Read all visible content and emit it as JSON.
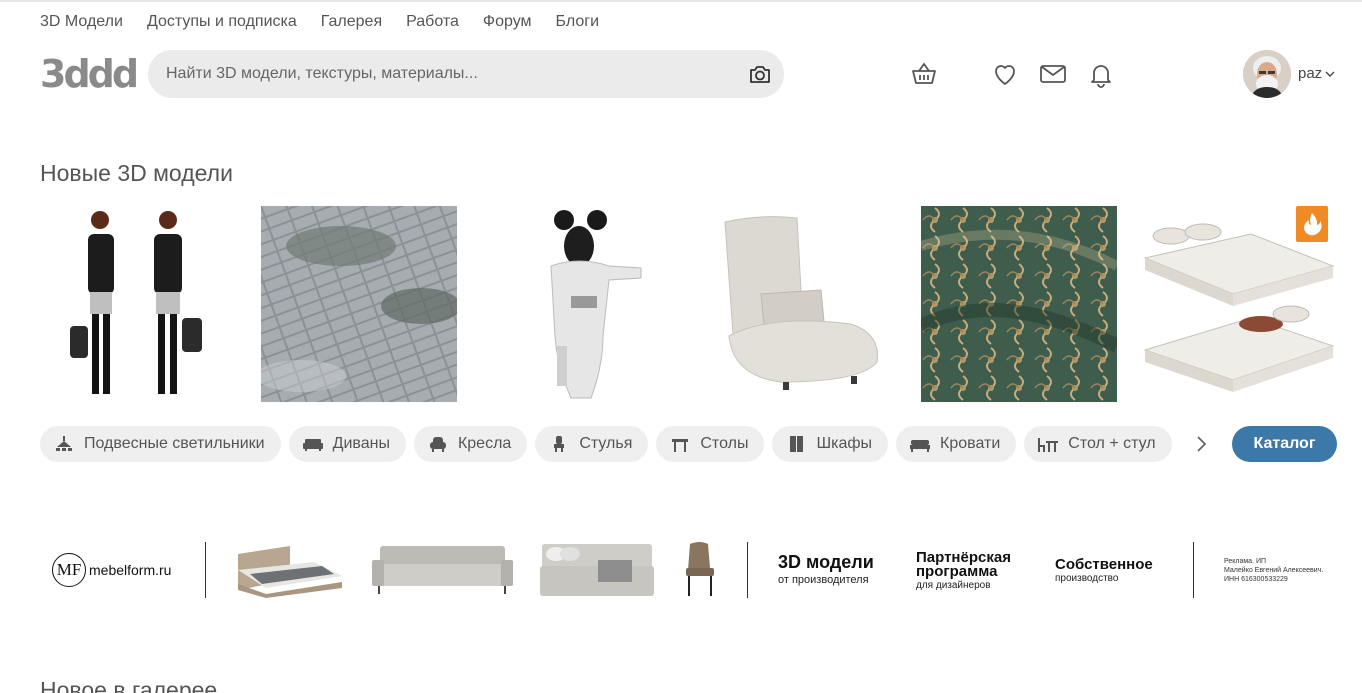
{
  "nav": {
    "items": [
      "3D Модели",
      "Доступы и подписка",
      "Галерея",
      "Работа",
      "Форум",
      "Блоги"
    ]
  },
  "logo": {
    "text": "3ddd"
  },
  "search": {
    "placeholder": "Найти 3D модели, текстуры, материалы...",
    "value": ""
  },
  "header_icons": [
    "basket-icon",
    "heart-icon",
    "mail-icon",
    "bell-icon"
  ],
  "user": {
    "name": "paz"
  },
  "new_models": {
    "title": "Новые 3D модели",
    "cards": [
      {
        "name": "people-model"
      },
      {
        "name": "paving-texture"
      },
      {
        "name": "sculpture-model"
      },
      {
        "name": "armchair-model"
      },
      {
        "name": "fabric-texture"
      },
      {
        "name": "beds-model",
        "badge": "fire-icon"
      }
    ]
  },
  "categories": [
    {
      "label": "Подвесные светильники",
      "icon": "pendant-lamp-icon"
    },
    {
      "label": "Диваны",
      "icon": "sofa-icon"
    },
    {
      "label": "Кресла",
      "icon": "armchair-icon"
    },
    {
      "label": "Стулья",
      "icon": "chair-icon"
    },
    {
      "label": "Столы",
      "icon": "table-icon"
    },
    {
      "label": "Шкафы",
      "icon": "wardrobe-icon"
    },
    {
      "label": "Кровати",
      "icon": "bed-icon"
    },
    {
      "label": "Стол + стул",
      "icon": "table-chair-icon"
    }
  ],
  "catalog_button": "Каталог",
  "banner": {
    "brand_mark": "MF",
    "brand": "mebelform.ru",
    "promo1_big": "3D модели",
    "promo1_small": "от производителя",
    "promo2_big_1": "Партнёрская",
    "promo2_big_2": "программа",
    "promo2_small": "для дизайнеров",
    "promo3_big": "Собственное",
    "promo3_small": "производство",
    "legal_1": "Реклама. ИП",
    "legal_2": "Малейко Евгений Алексеевич.",
    "legal_3": "ИНН 616300533229"
  },
  "next_section": {
    "title": "Новое в галерее"
  },
  "colors": {
    "accent": "#3c78a8",
    "badge": "#f08a24",
    "chip_bg": "#efefef",
    "search_bg": "#ebebeb"
  }
}
